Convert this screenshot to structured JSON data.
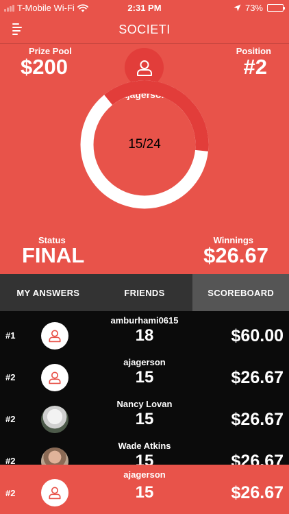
{
  "status_bar": {
    "carrier": "T-Mobile Wi-Fi",
    "time": "2:31 PM",
    "battery_text": "73%",
    "battery_level": 0.73,
    "icons": [
      "signal-icon",
      "wifi-icon",
      "location-icon",
      "battery-icon"
    ]
  },
  "header": {
    "title": "SOCIETI",
    "menu_icon": "menu-icon"
  },
  "hero": {
    "prize_pool_label": "Prize Pool",
    "prize_pool_value": "$200",
    "position_label": "Position",
    "position_value": "#2",
    "username": "ajagerson",
    "progress_text": "15/24",
    "progress": {
      "correct": 15,
      "total": 24
    },
    "status_label": "Status",
    "status_value": "FINAL",
    "winnings_label": "Winnings",
    "winnings_value": "$26.67"
  },
  "tabs": [
    {
      "label": "MY ANSWERS",
      "active": false
    },
    {
      "label": "FRIENDS",
      "active": false
    },
    {
      "label": "SCOREBOARD",
      "active": true
    }
  ],
  "scoreboard": [
    {
      "rank": "#1",
      "name": "amburhami0615",
      "score": "18",
      "amount": "$60.00",
      "avatar": "user-icon"
    },
    {
      "rank": "#2",
      "name": "ajagerson",
      "score": "15",
      "amount": "$26.67",
      "avatar": "user-icon"
    },
    {
      "rank": "#2",
      "name": "Nancy Lovan",
      "score": "15",
      "amount": "$26.67",
      "avatar": "photo"
    },
    {
      "rank": "#2",
      "name": "Wade Atkins",
      "score": "15",
      "amount": "$26.67",
      "avatar": "photo"
    }
  ],
  "current_user_row": {
    "rank": "#2",
    "name": "ajagerson",
    "score": "15",
    "amount": "$26.67"
  },
  "colors": {
    "brand_red": "#e8534a",
    "avatar_red": "#e23d3a",
    "progress_red": "#e23d3a",
    "progress_track": "#ffffff",
    "tab_bar": "#333333",
    "tab_active": "#555555",
    "list_bg": "#0b0b0b"
  }
}
